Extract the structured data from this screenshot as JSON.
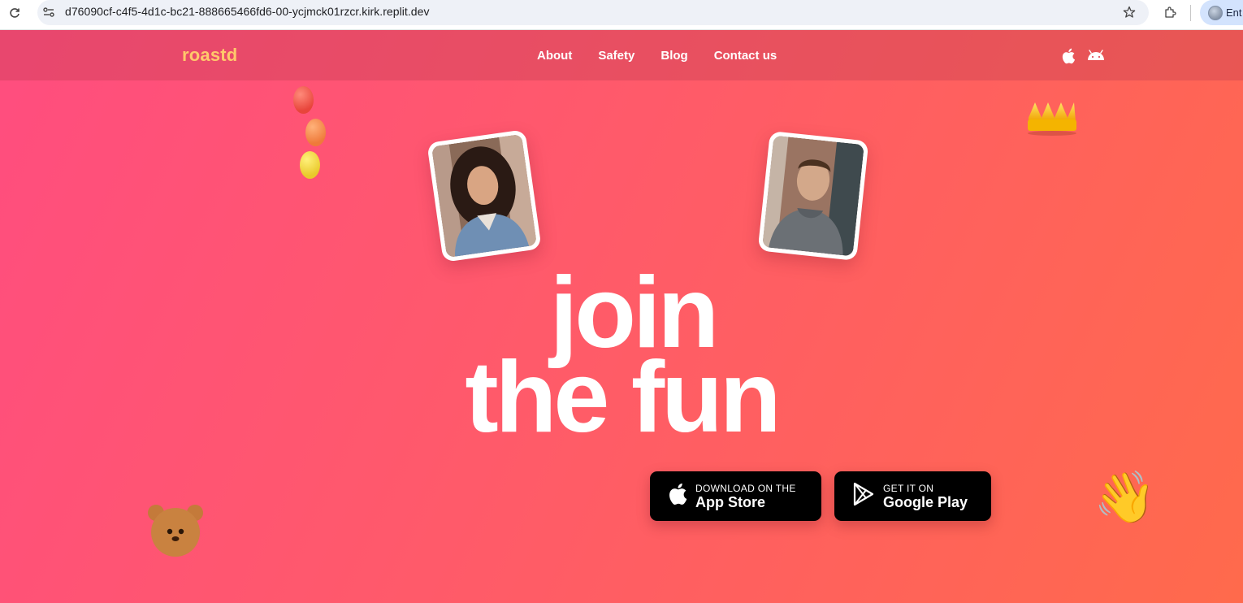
{
  "browser": {
    "url": "d76090cf-c4f5-4d1c-bc21-888665466fd6-00-ycjmck01rzcr.kirk.replit.dev",
    "profile_label": "Ent",
    "icons": [
      "reload-icon",
      "site-info-icon",
      "star-icon",
      "extensions-icon",
      "profile-avatar-icon"
    ]
  },
  "nav": {
    "logo": "roastd",
    "links": [
      "About",
      "Safety",
      "Blog",
      "Contact us"
    ],
    "platform_icons": [
      "apple-icon",
      "android-icon"
    ]
  },
  "hero": {
    "line1": "join",
    "line2": "the fun"
  },
  "store_buttons": {
    "appstore": {
      "small": "DOWNLOAD ON THE",
      "big": "App Store",
      "icon": "apple-icon"
    },
    "googleplay": {
      "small": "GET IT ON",
      "big": "Google Play",
      "icon": "google-play-icon"
    }
  },
  "decor": {
    "icons": [
      "balloon-icon",
      "crown-icon",
      "waving-hand-icon",
      "bear-icon"
    ],
    "wave_emoji": "👋"
  },
  "colors": {
    "logo": "#ffc86b",
    "gradient_start": "#ff4d7f",
    "gradient_end": "#ff6a4c",
    "store_button": "#000000"
  }
}
